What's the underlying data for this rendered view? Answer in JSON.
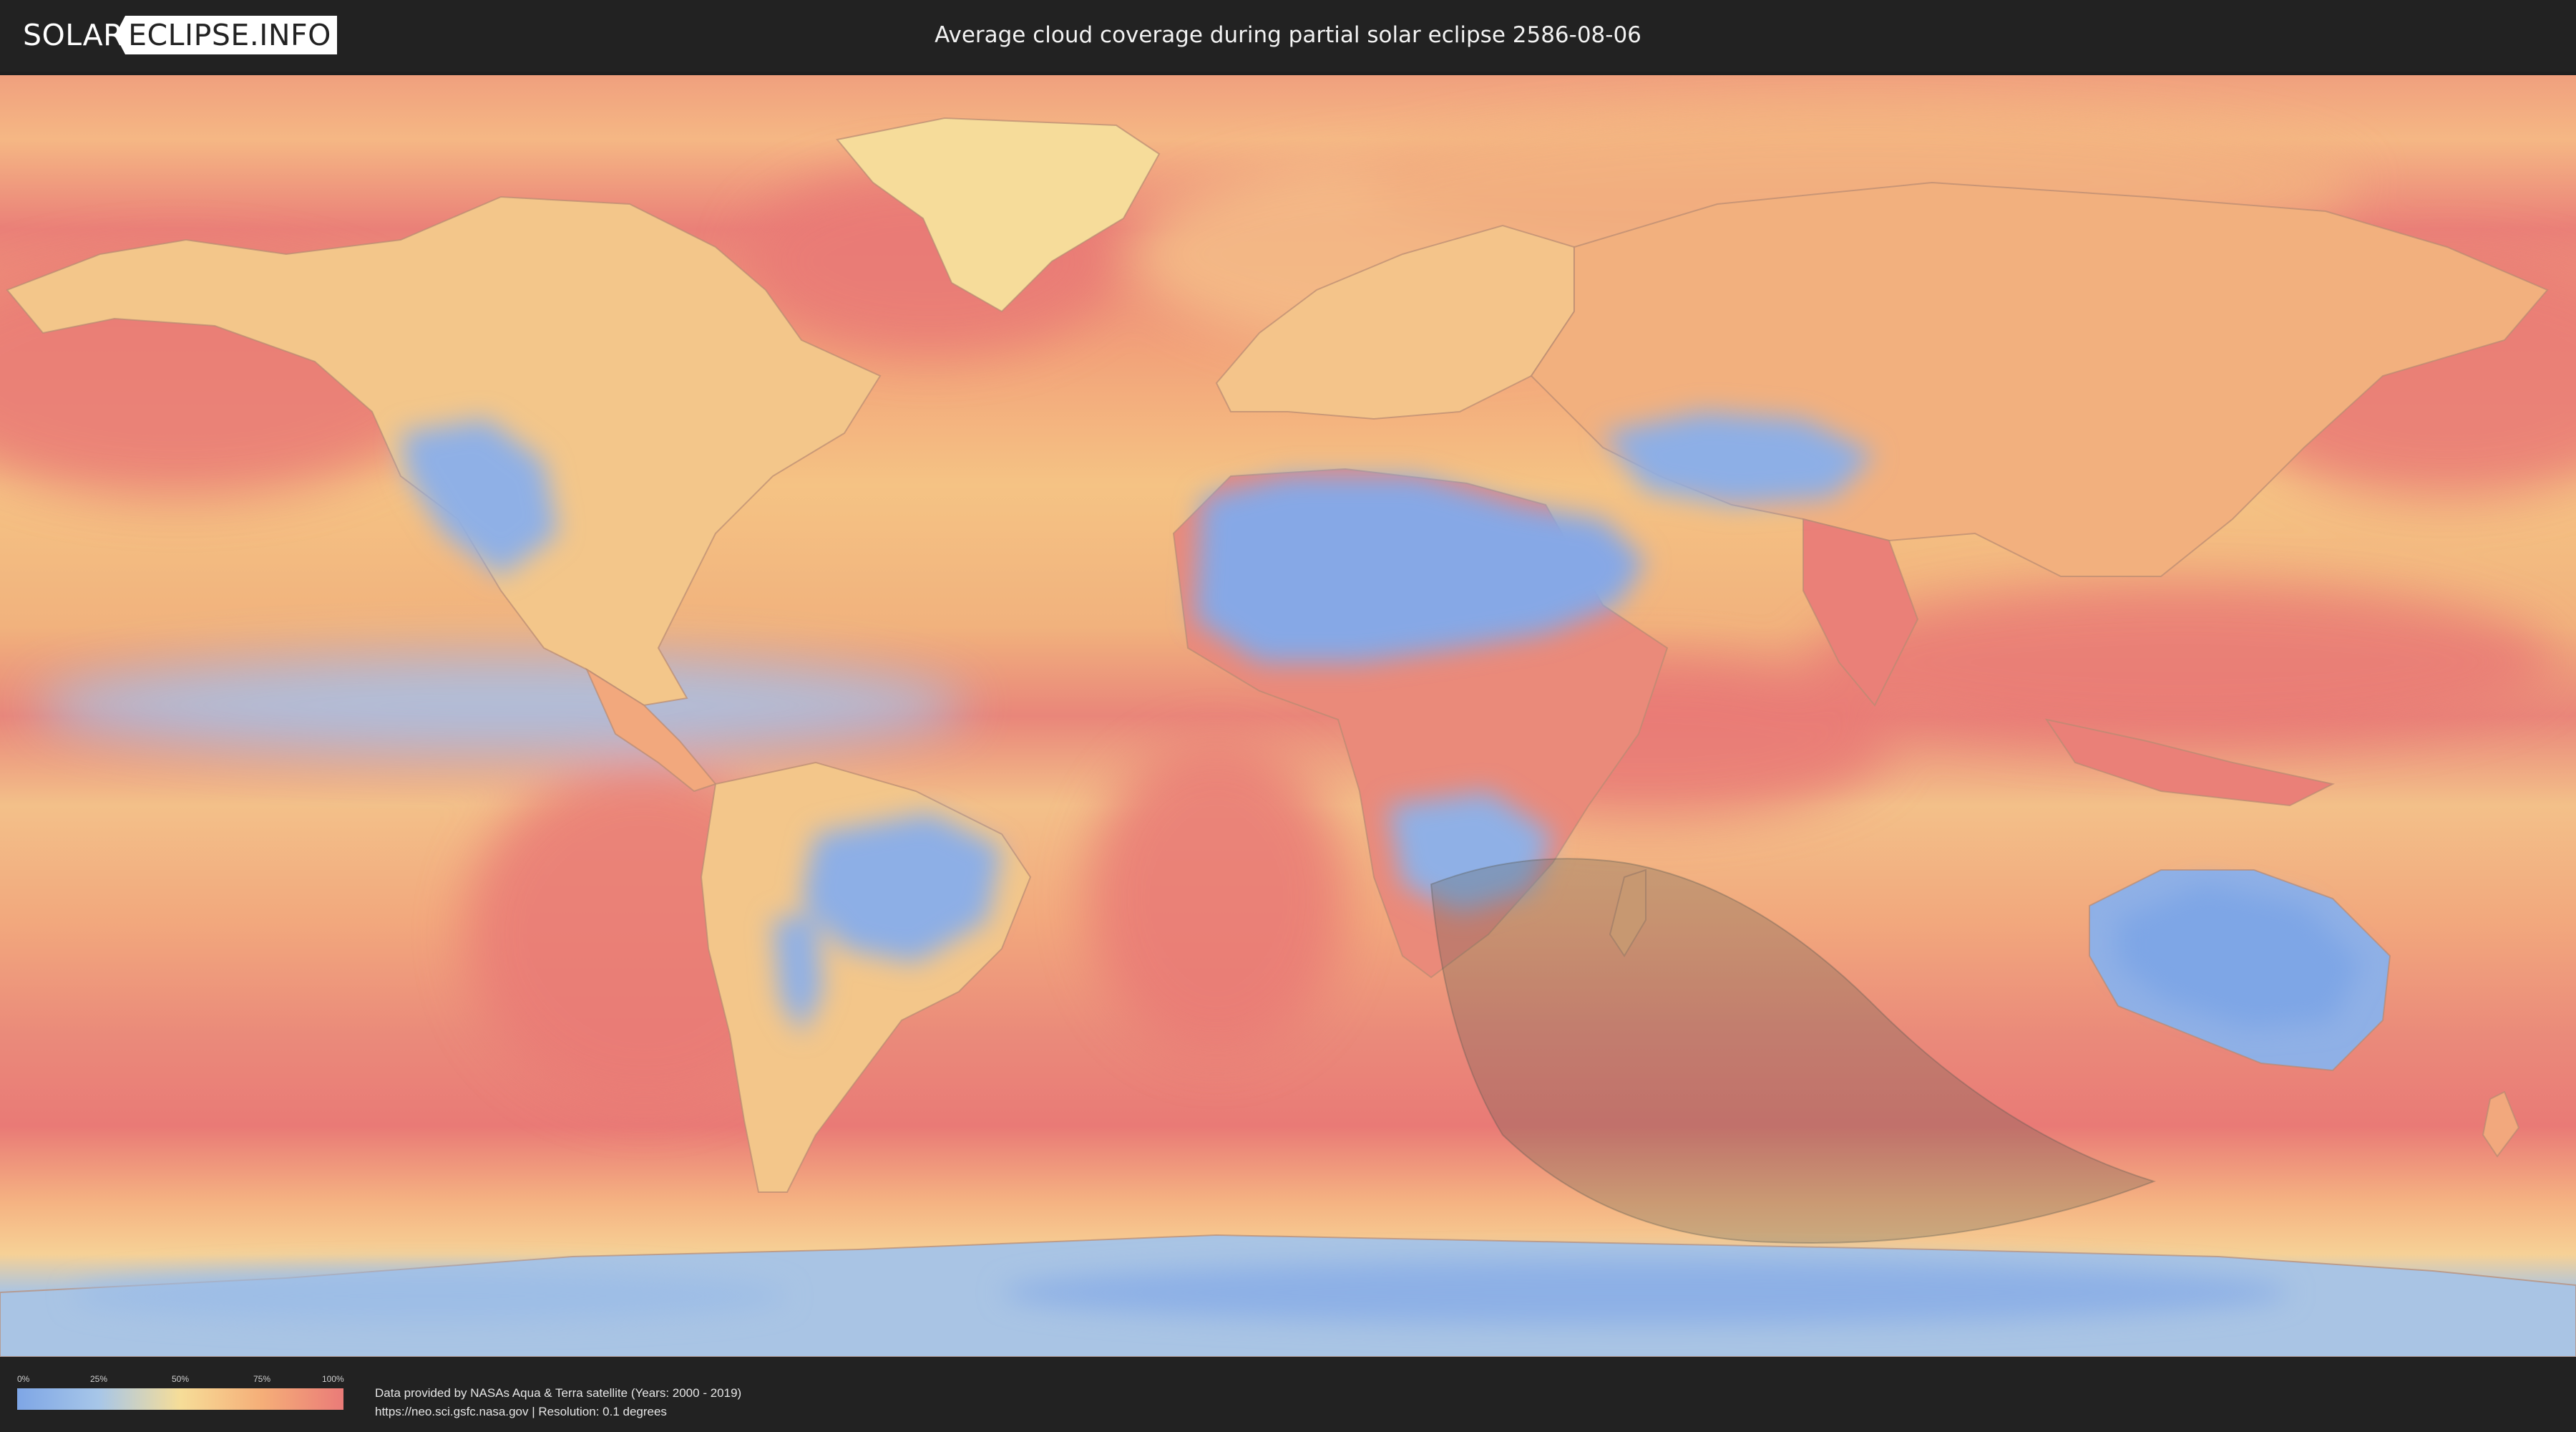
{
  "header": {
    "logo_left": "SOLAR",
    "logo_right": "ECLIPSE.INFO",
    "title": "Average cloud coverage during partial solar eclipse 2586-08-06"
  },
  "map": {
    "type": "world cloud coverage map (equirectangular)",
    "eclipse_region": "partial eclipse visibility area over southern Africa, southern Indian Ocean and Antarctic coast",
    "colors": {
      "clear": "#7ea6e6",
      "low": "#a7c6e8",
      "mid": "#f6dd98",
      "high": "#f5ae78",
      "overcast": "#ea7b78",
      "eclipse_shade": "#5a5a50"
    }
  },
  "legend": {
    "ticks": [
      "0%",
      "25%",
      "50%",
      "75%",
      "100%"
    ],
    "values": [
      0,
      25,
      50,
      75,
      100
    ]
  },
  "credits": {
    "line1": "Data provided by NASAs Aqua & Terra satellite (Years: 2000 - 2019)",
    "line2": "https://neo.sci.gsfc.nasa.gov | Resolution: 0.1 degrees"
  }
}
